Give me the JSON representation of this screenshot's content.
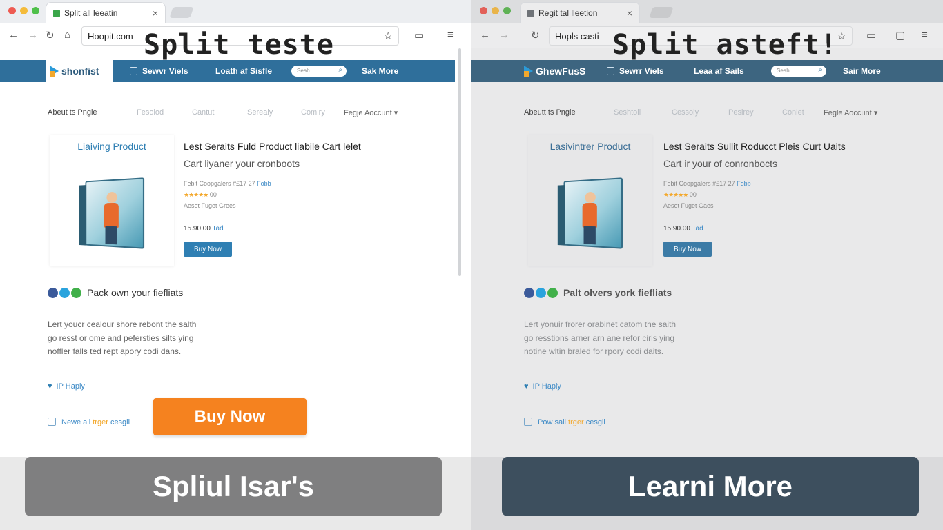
{
  "left": {
    "tab_title": "Split all leeatin",
    "url": "Hoopit.com",
    "overlay_title": "Split teste",
    "site": {
      "logo": "shonfist",
      "nav_1": "Sewvr Viels",
      "nav_2": "Loath af Sisfle",
      "search_placeholder": "Seah",
      "nav_3": "Sak More"
    },
    "subnav": {
      "item_1": "Abeut ts Pngle",
      "item_2": "Fesoiod",
      "item_3": "Cantut",
      "item_4": "Serealy",
      "item_5": "Comiry",
      "account": "Fegje Aoccunt"
    },
    "product": {
      "card_title": "Liaiving Product",
      "title": "Lest Seraits Fuld Product liabile Cart lelet",
      "subtitle": "Cart liyaner your cronboots",
      "meta_1": "Febit Coopgalers",
      "meta_1_num": "#£17 27",
      "meta_1_link": "Fobb",
      "rating": "★★★★★",
      "rating_count": "00",
      "meta_3": "Aeset Fuget Grees",
      "price": "15.90.00",
      "price_suffix": "Tad",
      "buy_small": "Buy Now"
    },
    "social_text": "Pack own your fiefliats",
    "body": [
      "Lert youcr cealour shore rebont the salth",
      "go resst or ome and pefersties silts ying",
      "noffler falls ted rept apory codi dans."
    ],
    "heart_text": "IP Haply",
    "cart_text_1": "Newe all",
    "cart_text_orange": "trger",
    "cart_text_2": "cesgil",
    "buy_big": "Buy Now",
    "banner": "Spliul Isar's"
  },
  "right": {
    "tab_title": "Regit tal lleetion",
    "url": "Hopls casti",
    "overlay_title": "Split asteft!",
    "site": {
      "logo": "GhewFusS",
      "nav_1": "Sewrr Viels",
      "nav_2": "Leaa af Sails",
      "search_placeholder": "Seah",
      "nav_3": "Sair More"
    },
    "subnav": {
      "item_1": "Abeutt ts Pngle",
      "item_2": "Seshtoil",
      "item_3": "Cessoiy",
      "item_4": "Pesirey",
      "item_5": "Coniet",
      "account": "Fegle Aoccunt"
    },
    "product": {
      "card_title": "Lasivintrer Product",
      "title": "Lest Seraits Sullit Roducct Pleis Curt Uaits",
      "subtitle": "Cart ir your of conronbocts",
      "meta_1": "Febit Coopgalers",
      "meta_1_num": "#£17 27",
      "meta_1_link": "Fobb",
      "rating": "★★★★★",
      "rating_count": "00",
      "meta_3": "Aeset Fuget Gaes",
      "price": "15.90.00",
      "price_suffix": "Tad",
      "buy_small": "Buy Now"
    },
    "social_text": "Palt olvers york fiefliats",
    "body": [
      "Lert yonuir frorer orabinet catom the saith",
      "go resstions arner arn ane refor cirls ying",
      "notine wltin braled for rpory codi daits."
    ],
    "heart_text": "IP Haply",
    "cart_text_1": "Pow sall",
    "cart_text_orange": "trger",
    "cart_text_2": "cesgil",
    "banner": "Learni More"
  },
  "colors": {
    "accent_blue": "#2f6f9b",
    "cta_orange": "#f5821f",
    "banner_gray": "#7f7f80",
    "banner_slate": "#3d4f5e"
  }
}
